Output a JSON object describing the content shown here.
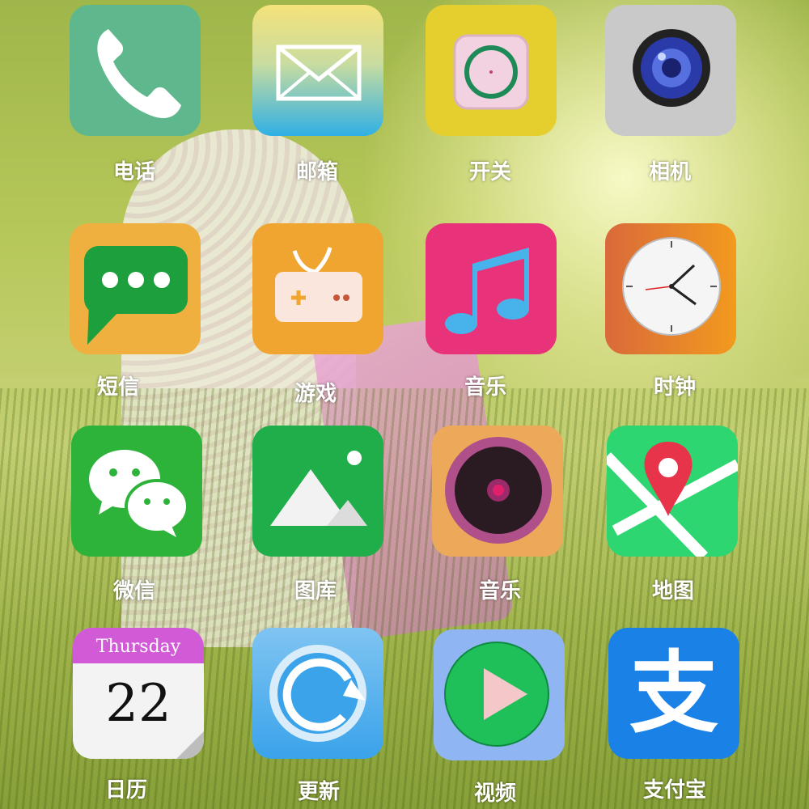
{
  "apps": {
    "phone": {
      "label": "电话"
    },
    "mail": {
      "label": "邮箱"
    },
    "switch": {
      "label": "开关"
    },
    "camera": {
      "label": "相机"
    },
    "sms": {
      "label": "短信"
    },
    "games": {
      "label": "游戏"
    },
    "music": {
      "label": "音乐"
    },
    "clock": {
      "label": "时钟"
    },
    "wechat": {
      "label": "微信"
    },
    "gallery": {
      "label": "图库"
    },
    "music2": {
      "label": "音乐"
    },
    "maps": {
      "label": "地图"
    },
    "calendar": {
      "label": "日历",
      "weekday": "Thursday",
      "day": "22"
    },
    "update": {
      "label": "更新"
    },
    "video": {
      "label": "视频"
    },
    "alipay": {
      "label": "支付宝",
      "glyph": "支"
    }
  },
  "colors": {
    "phone": "#5fb78d",
    "mail_top": "#f4e27a",
    "mail_bottom": "#2fb0e5",
    "switch": "#e4cf2e",
    "camera": "#c9c9c9",
    "sms": "#f0b040",
    "sms_bubble": "#1e9f3d",
    "games": "#f0a531",
    "music": "#e8337a",
    "clock_from": "#d96a3a",
    "clock_to": "#f29a1e",
    "wechat": "#2eb33a",
    "gallery": "#1fae4a",
    "music2": "#eda95a",
    "maps": "#2ed672",
    "calendar_band": "#d15ad6",
    "update": "#3aa3ea",
    "video": "#8fb6f2",
    "alipay": "#1a82e6"
  }
}
